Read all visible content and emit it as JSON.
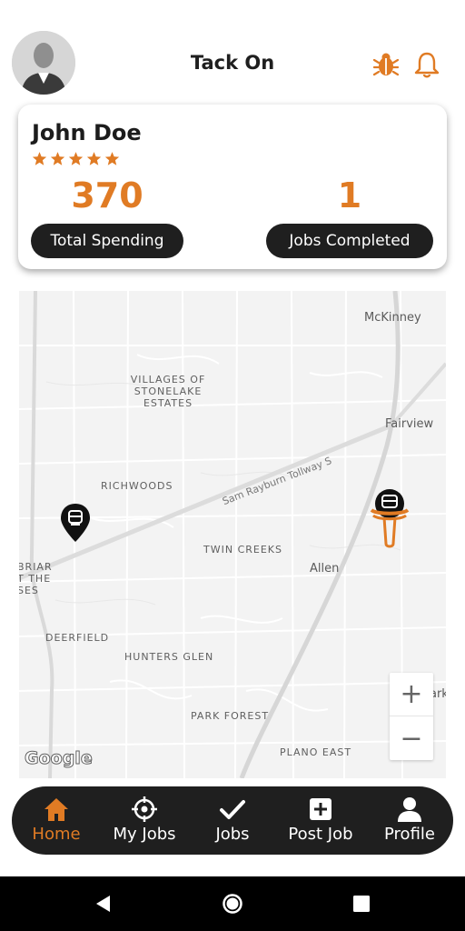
{
  "header": {
    "title": "Tack On",
    "icons": [
      "user-avatar",
      "bug-icon",
      "bell-icon"
    ]
  },
  "profile": {
    "name": "John Doe",
    "rating": 5,
    "rating_max": 5,
    "stats": [
      {
        "value": "370",
        "label": "Total Spending"
      },
      {
        "value": "1",
        "label": "Jobs Completed"
      }
    ]
  },
  "map": {
    "areas": [
      {
        "id": "villages",
        "text": "VILLAGES OF\nSTONELAKE\nESTATES"
      },
      {
        "id": "richwoods",
        "text": "RICHWOODS"
      },
      {
        "id": "twin-creeks",
        "text": "TWIN CREEKS"
      },
      {
        "id": "deerfield",
        "text": "DEERFIELD"
      },
      {
        "id": "hunters-glen",
        "text": "HUNTERS GLEN"
      },
      {
        "id": "park-forest",
        "text": "PARK FOREST"
      },
      {
        "id": "plano-east",
        "text": "PLANO EAST"
      },
      {
        "id": "briar",
        "text": "BRIAR\nT THE\nSES"
      }
    ],
    "cities": [
      {
        "id": "mckinney",
        "text": "McKinney"
      },
      {
        "id": "fairview",
        "text": "Fairview"
      },
      {
        "id": "allen",
        "text": "Allen"
      },
      {
        "id": "parker",
        "text": "arke"
      }
    ],
    "road": "Sam Rayburn Tollway S",
    "zoom_in": "+",
    "zoom_out": "−",
    "attribution": "Google"
  },
  "nav": {
    "items": [
      {
        "label": "Home",
        "icon": "home-icon",
        "active": true
      },
      {
        "label": "My Jobs",
        "icon": "crosshair-icon",
        "active": false
      },
      {
        "label": "Jobs",
        "icon": "check-icon",
        "active": false
      },
      {
        "label": "Post Job",
        "icon": "plus-box-icon",
        "active": false
      },
      {
        "label": "Profile",
        "icon": "person-icon",
        "active": false
      }
    ]
  },
  "colors": {
    "accent": "#e07b24",
    "dark": "#1f1f1f",
    "map_bg": "#f3f3f3"
  }
}
